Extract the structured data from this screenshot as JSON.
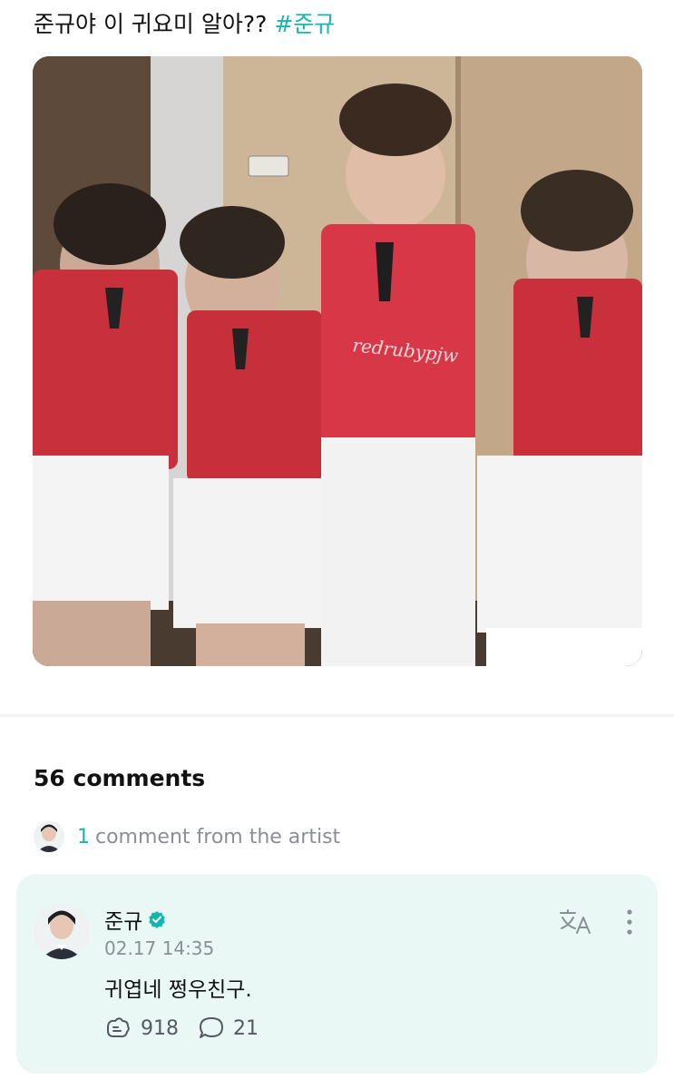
{
  "post": {
    "text": "준규야 이 귀요미 알아??",
    "hashtag": "#준규",
    "photo_watermark": "redrubypjw"
  },
  "comments_section": {
    "count_label": "56 comments",
    "artist_count": "1",
    "artist_label": "comment from the artist"
  },
  "comment": {
    "author": "준규",
    "timestamp": "02.17 14:35",
    "body": "귀엽네 쩡우친구.",
    "likes": "918",
    "replies": "21"
  },
  "colors": {
    "accent": "#16b6b0",
    "card_bg": "#e9f8f5",
    "muted": "#8a8f96"
  },
  "icons": [
    "verified-badge-icon",
    "translate-icon",
    "more-icon",
    "like-icon",
    "reply-icon"
  ]
}
